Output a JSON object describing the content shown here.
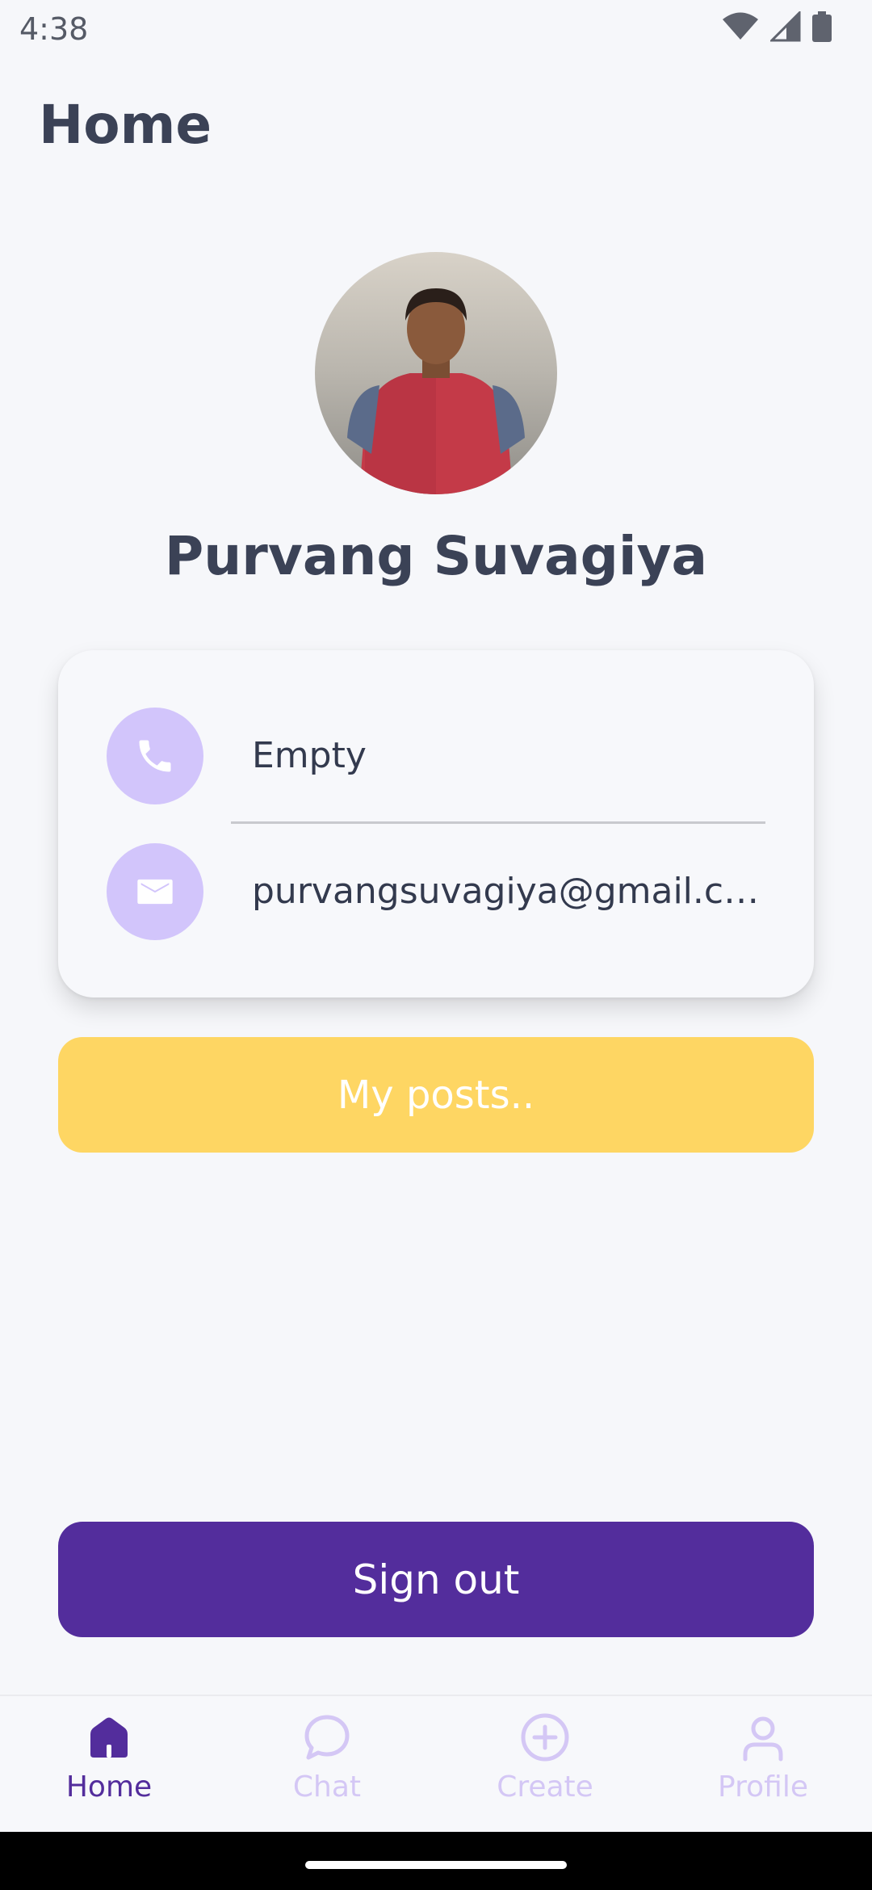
{
  "status_bar": {
    "time": "4:38",
    "icons": [
      "wifi-icon",
      "signal-icon",
      "battery-icon"
    ]
  },
  "header": {
    "title": "Home"
  },
  "profile": {
    "name": "Purvang Suvagiya"
  },
  "contact": {
    "phone": {
      "icon": "phone-icon",
      "value": "Empty"
    },
    "email": {
      "icon": "mail-icon",
      "value": "purvangsuvagiya@gmail.c…"
    }
  },
  "actions": {
    "my_posts_label": "My posts..",
    "sign_out_label": "Sign out"
  },
  "bottom_nav": {
    "items": [
      {
        "label": "Home",
        "icon": "home-icon",
        "active": true
      },
      {
        "label": "Chat",
        "icon": "chat-icon",
        "active": false
      },
      {
        "label": "Create",
        "icon": "add-circle-icon",
        "active": false
      },
      {
        "label": "Profile",
        "icon": "profile-icon",
        "active": false
      }
    ]
  },
  "colors": {
    "background": "#f6f7fa",
    "accent_purple": "#532d9c",
    "icon_circle": "#d2c5fb",
    "posts_button": "#fed663",
    "text_dark": "#3b4256",
    "nav_inactive": "#d4c7f5"
  }
}
